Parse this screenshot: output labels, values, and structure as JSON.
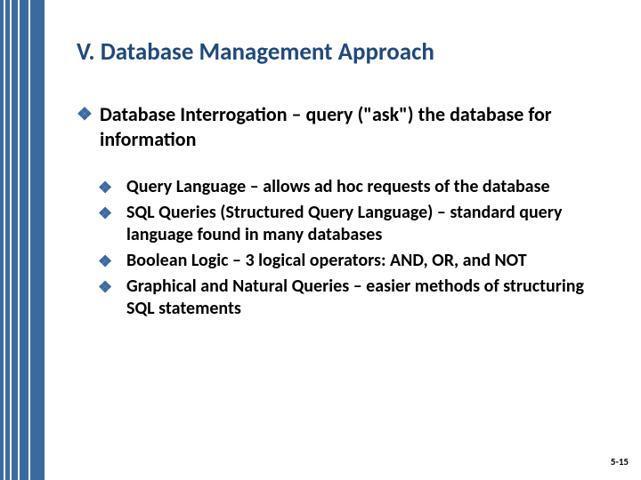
{
  "title": "V. Database Management Approach",
  "main": {
    "bullet_glyph": "❖",
    "text": "Database Interrogation – query (\"ask\") the database for information"
  },
  "sub": [
    {
      "bullet_glyph": "❖",
      "text": "Query Language – allows ad hoc requests of the database"
    },
    {
      "bullet_glyph": "❖",
      "text": "SQL Queries (Structured Query Language) – standard query language found in many databases"
    },
    {
      "bullet_glyph": "❖",
      "text": "Boolean Logic – 3 logical operators: AND, OR, and NOT"
    },
    {
      "bullet_glyph": "❖",
      "text": "Graphical and Natural Queries – easier methods of structuring SQL statements"
    }
  ],
  "page_number": "5-15"
}
